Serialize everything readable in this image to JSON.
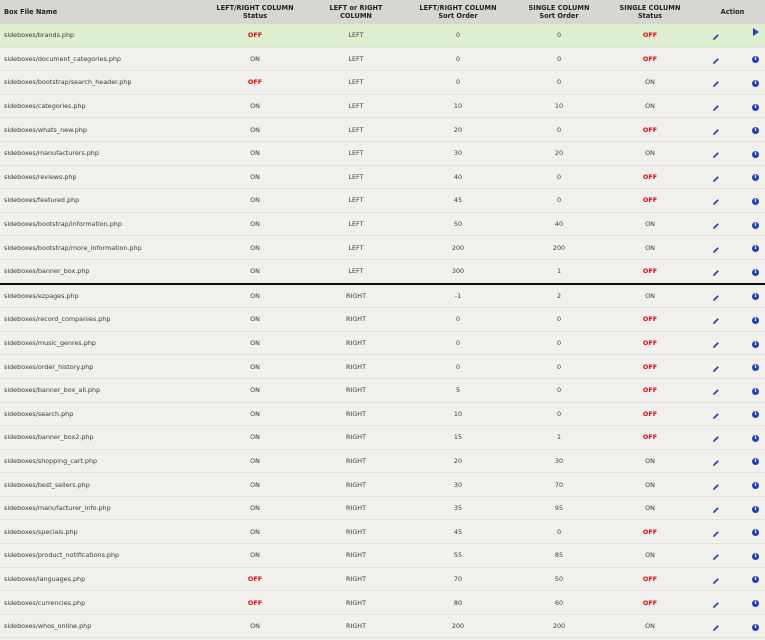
{
  "headers": {
    "file": "Box File Name",
    "lr_status": [
      "LEFT/RIGHT COLUMN",
      "Status"
    ],
    "lr_column": [
      "LEFT or RIGHT",
      "COLUMN"
    ],
    "lr_sort": [
      "LEFT/RIGHT COLUMN",
      "Sort Order"
    ],
    "single_sort": [
      "SINGLE COLUMN",
      "Sort Order"
    ],
    "single_status": [
      "SINGLE COLUMN",
      "Status"
    ],
    "action": "Action"
  },
  "colors": {
    "off": "#e8000b",
    "selected_row": "#ddefcf",
    "header_bg": "#d8d6d1",
    "icon_blue": "#1f3fb8"
  },
  "icons": {
    "edit": "pencil-icon",
    "info": "info-icon",
    "selected": "play-arrow-icon"
  },
  "rows": [
    {
      "file": "sideboxes/brands.php",
      "lr_status": "OFF",
      "column": "LEFT",
      "lr_sort": "0",
      "single_sort": "0",
      "single_status": "OFF",
      "selected": true
    },
    {
      "file": "sideboxes/document_categories.php",
      "lr_status": "ON",
      "column": "LEFT",
      "lr_sort": "0",
      "single_sort": "0",
      "single_status": "OFF"
    },
    {
      "file": "sideboxes/bootstrap/search_header.php",
      "lr_status": "OFF",
      "column": "LEFT",
      "lr_sort": "0",
      "single_sort": "0",
      "single_status": "ON"
    },
    {
      "file": "sideboxes/categories.php",
      "lr_status": "ON",
      "column": "LEFT",
      "lr_sort": "10",
      "single_sort": "10",
      "single_status": "ON"
    },
    {
      "file": "sideboxes/whats_new.php",
      "lr_status": "ON",
      "column": "LEFT",
      "lr_sort": "20",
      "single_sort": "0",
      "single_status": "OFF"
    },
    {
      "file": "sideboxes/manufacturers.php",
      "lr_status": "ON",
      "column": "LEFT",
      "lr_sort": "30",
      "single_sort": "20",
      "single_status": "ON"
    },
    {
      "file": "sideboxes/reviews.php",
      "lr_status": "ON",
      "column": "LEFT",
      "lr_sort": "40",
      "single_sort": "0",
      "single_status": "OFF"
    },
    {
      "file": "sideboxes/featured.php",
      "lr_status": "ON",
      "column": "LEFT",
      "lr_sort": "45",
      "single_sort": "0",
      "single_status": "OFF"
    },
    {
      "file": "sideboxes/bootstrap/information.php",
      "lr_status": "ON",
      "column": "LEFT",
      "lr_sort": "50",
      "single_sort": "40",
      "single_status": "ON"
    },
    {
      "file": "sideboxes/bootstrap/more_information.php",
      "lr_status": "ON",
      "column": "LEFT",
      "lr_sort": "200",
      "single_sort": "200",
      "single_status": "ON"
    },
    {
      "file": "sideboxes/banner_box.php",
      "lr_status": "ON",
      "column": "LEFT",
      "lr_sort": "300",
      "single_sort": "1",
      "single_status": "OFF",
      "divider": true
    },
    {
      "file": "sideboxes/ezpages.php",
      "lr_status": "ON",
      "column": "RIGHT",
      "lr_sort": "-1",
      "single_sort": "2",
      "single_status": "ON"
    },
    {
      "file": "sideboxes/record_companies.php",
      "lr_status": "ON",
      "column": "RIGHT",
      "lr_sort": "0",
      "single_sort": "0",
      "single_status": "OFF"
    },
    {
      "file": "sideboxes/music_genres.php",
      "lr_status": "ON",
      "column": "RIGHT",
      "lr_sort": "0",
      "single_sort": "0",
      "single_status": "OFF"
    },
    {
      "file": "sideboxes/order_history.php",
      "lr_status": "ON",
      "column": "RIGHT",
      "lr_sort": "0",
      "single_sort": "0",
      "single_status": "OFF"
    },
    {
      "file": "sideboxes/banner_box_all.php",
      "lr_status": "ON",
      "column": "RIGHT",
      "lr_sort": "5",
      "single_sort": "0",
      "single_status": "OFF"
    },
    {
      "file": "sideboxes/search.php",
      "lr_status": "ON",
      "column": "RIGHT",
      "lr_sort": "10",
      "single_sort": "0",
      "single_status": "OFF"
    },
    {
      "file": "sideboxes/banner_box2.php",
      "lr_status": "ON",
      "column": "RIGHT",
      "lr_sort": "15",
      "single_sort": "1",
      "single_status": "OFF"
    },
    {
      "file": "sideboxes/shopping_cart.php",
      "lr_status": "ON",
      "column": "RIGHT",
      "lr_sort": "20",
      "single_sort": "30",
      "single_status": "ON"
    },
    {
      "file": "sideboxes/best_sellers.php",
      "lr_status": "ON",
      "column": "RIGHT",
      "lr_sort": "30",
      "single_sort": "70",
      "single_status": "ON"
    },
    {
      "file": "sideboxes/manufacturer_info.php",
      "lr_status": "ON",
      "column": "RIGHT",
      "lr_sort": "35",
      "single_sort": "95",
      "single_status": "ON"
    },
    {
      "file": "sideboxes/specials.php",
      "lr_status": "ON",
      "column": "RIGHT",
      "lr_sort": "45",
      "single_sort": "0",
      "single_status": "OFF"
    },
    {
      "file": "sideboxes/product_notifications.php",
      "lr_status": "ON",
      "column": "RIGHT",
      "lr_sort": "55",
      "single_sort": "85",
      "single_status": "ON"
    },
    {
      "file": "sideboxes/languages.php",
      "lr_status": "OFF",
      "column": "RIGHT",
      "lr_sort": "70",
      "single_sort": "50",
      "single_status": "OFF"
    },
    {
      "file": "sideboxes/currencies.php",
      "lr_status": "OFF",
      "column": "RIGHT",
      "lr_sort": "80",
      "single_sort": "60",
      "single_status": "OFF"
    },
    {
      "file": "sideboxes/whos_online.php",
      "lr_status": "ON",
      "column": "RIGHT",
      "lr_sort": "200",
      "single_sort": "200",
      "single_status": "ON"
    }
  ]
}
